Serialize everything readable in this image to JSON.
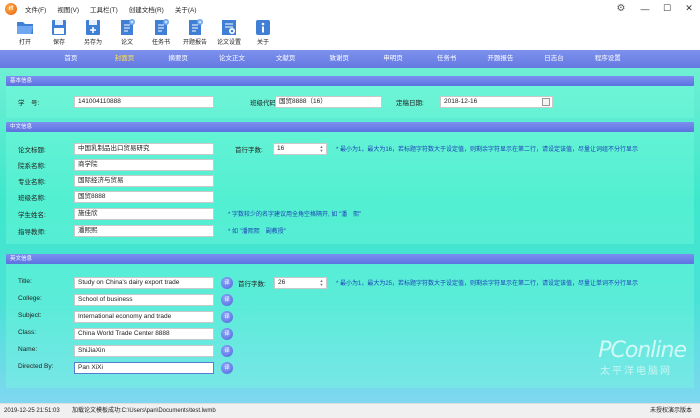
{
  "menu": {
    "logo": "rf",
    "items": [
      "文件(F)",
      "视图(V)",
      "工具栏(T)",
      "创建文档(R)",
      "关于(A)"
    ]
  },
  "window": {
    "gear": "⚙",
    "minimize": "—",
    "maximize": "☐",
    "close": "✕"
  },
  "toolbar": {
    "items": [
      {
        "label": "打开",
        "icon": "folder-open-icon"
      },
      {
        "label": "保存",
        "icon": "save-icon"
      },
      {
        "label": "另存为",
        "icon": "save-as-icon"
      },
      {
        "label": "论文",
        "icon": "add-paper-icon"
      },
      {
        "label": "任务书",
        "icon": "add-taskbook-icon"
      },
      {
        "label": "开题报告",
        "icon": "add-proposal-icon"
      },
      {
        "label": "论文设置",
        "icon": "settings-doc-icon"
      },
      {
        "label": "关于",
        "icon": "info-icon"
      }
    ]
  },
  "nav": {
    "tabs": [
      "首页",
      "封面页",
      "摘要页",
      "论文正文",
      "文献页",
      "致谢页",
      "申明页",
      "任务书",
      "开题报告",
      "日志台",
      "程序设置"
    ],
    "active_index": 1
  },
  "basic": {
    "header": "基本信息",
    "student_no_label": "学　号:",
    "student_no": "141004110888",
    "class_code_label": "班级代码:",
    "class_code": "国贸8888（16）",
    "due_date_label": "定稿日期:",
    "due_date": "2018-12-16"
  },
  "chinese": {
    "header": "中文信息",
    "title_label": "论文标题:",
    "title": "中国乳制品出口贸易研究",
    "first_line_label": "首行字数:",
    "first_line_value": "16",
    "first_line_hint": "* 最小为1，最大为16，若标题字符数大于设定值，则剩余字符显示在第二行，请设定该值，尽量让词组不分行显示",
    "college_label": "院系名称:",
    "college": "商学院",
    "major_label": "专业名称:",
    "major": "国际经济与贸易",
    "class_label": "班级名称:",
    "class_name": "国贸8888",
    "student_label": "学生姓名:",
    "student": "施佳欣",
    "student_hint": "* 字数较少的名字建议用全角空格隔开, 如 \"潘　熙\"",
    "advisor_label": "指导教师:",
    "advisor": "潘熙熙",
    "advisor_hint": "* 如 \"潘熙熙　副教授\""
  },
  "english": {
    "header": "英文信息",
    "title_label": "Title:",
    "title": "Study on China's dairy export trade",
    "first_line_label": "首行字数:",
    "first_line_value": "26",
    "first_line_hint": "* 最小为1，最大为25，若标题字符数大于设定值，则剩余字符显示在第二行，请设定该值，尽量让单词不分行显示",
    "college_label": "College:",
    "college": "School of business",
    "subject_label": "Subject:",
    "subject": "International economy and trade",
    "class_label": "Class:",
    "class_name": "China World Trade Center 8888",
    "name_label": "Name:",
    "name": "ShiJiaXin",
    "directed_label": "Directed By:",
    "directed": "Pan XiXi",
    "translate_label": "译"
  },
  "status": {
    "timestamp": "2019-12-25 21:51:03",
    "message": "加载论文模板成功:C:\\Users\\pan\\Documents\\test.lwmb",
    "right": "未授权演示版本"
  },
  "watermark": {
    "brand": "PConline",
    "sub": "太平洋电脑网"
  },
  "colors": {
    "nav": "#6a7ee6",
    "active_tab": "#ffe14d",
    "content": "#3ee7cc",
    "hint": "#1d3fb8"
  }
}
